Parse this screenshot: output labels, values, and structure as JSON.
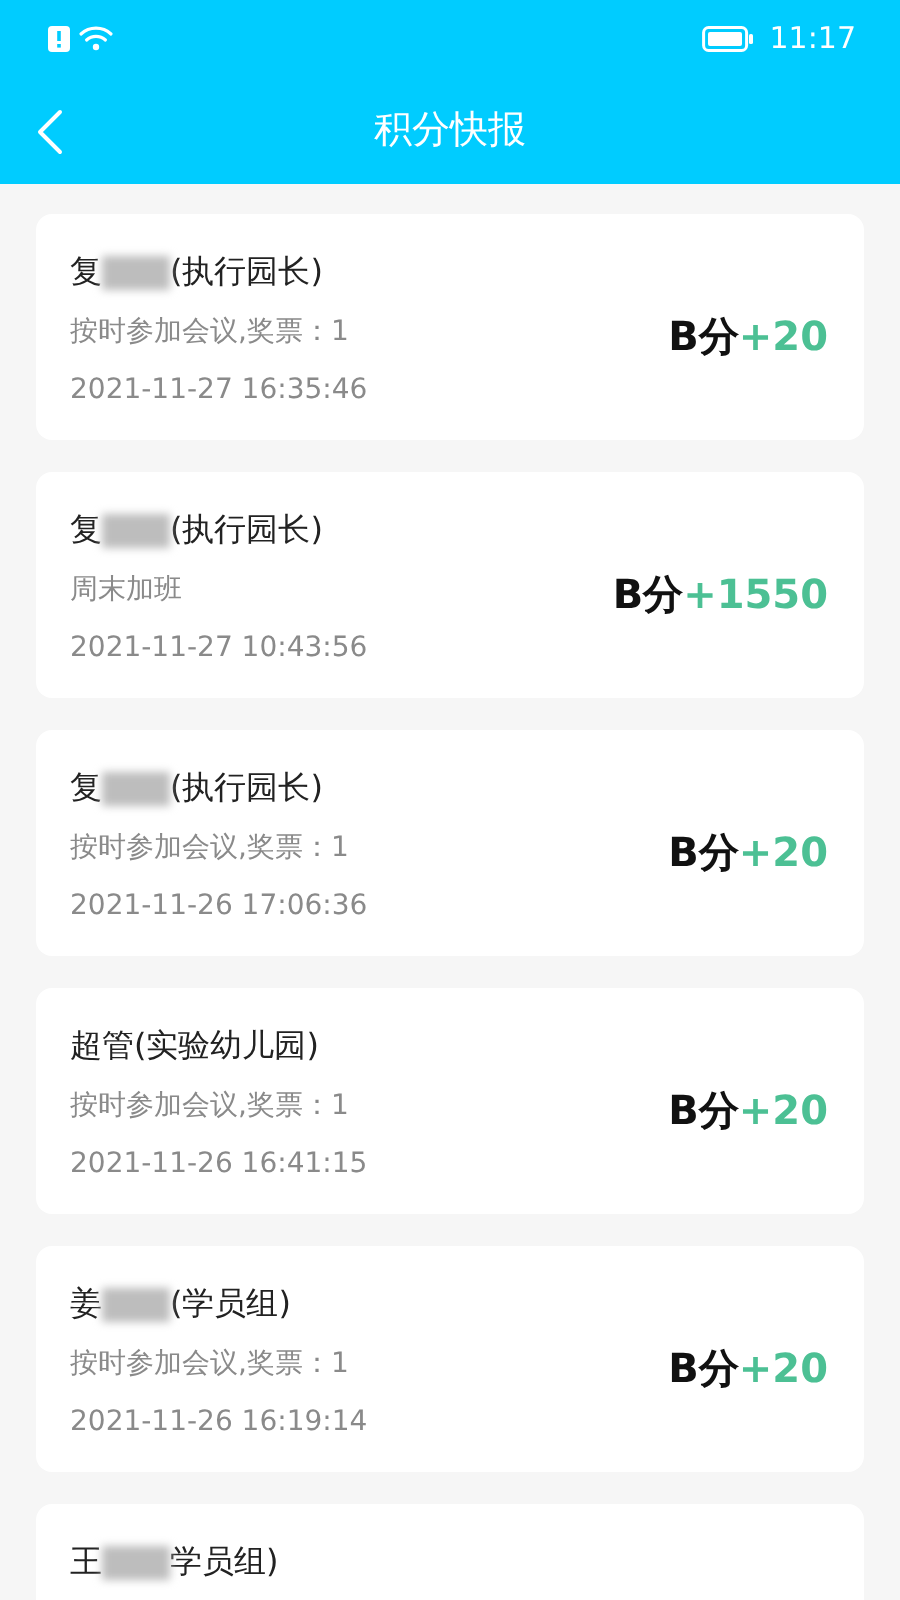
{
  "status_bar": {
    "time": "11:17"
  },
  "header": {
    "title": "积分快报"
  },
  "records": [
    {
      "name_start": "复",
      "redacted": true,
      "name_end": "(执行园长)",
      "description": "按时参加会议,奖票：1",
      "time": "2021-11-27 16:35:46",
      "points_label": "B分",
      "points_value": "+20"
    },
    {
      "name_start": "复",
      "redacted": true,
      "name_end": "(执行园长)",
      "description": "周末加班",
      "time": "2021-11-27 10:43:56",
      "points_label": "B分",
      "points_value": "+1550"
    },
    {
      "name_start": "复",
      "redacted": true,
      "name_end": "(执行园长)",
      "description": "按时参加会议,奖票：1",
      "time": "2021-11-26 17:06:36",
      "points_label": "B分",
      "points_value": "+20"
    },
    {
      "name_start": "超管(实验幼儿园)",
      "redacted": false,
      "description": "按时参加会议,奖票：1",
      "time": "2021-11-26 16:41:15",
      "points_label": "B分",
      "points_value": "+20"
    },
    {
      "name_start": "姜",
      "redacted": true,
      "name_end": "(学员组)",
      "description": "按时参加会议,奖票：1",
      "time": "2021-11-26 16:19:14",
      "points_label": "B分",
      "points_value": "+20"
    },
    {
      "name_start": "王",
      "redacted": true,
      "name_end": "学员组)"
    }
  ]
}
